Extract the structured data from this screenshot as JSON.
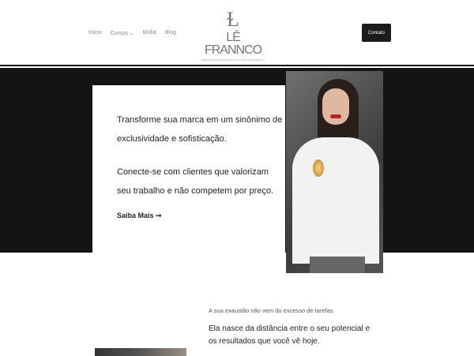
{
  "header": {
    "nav": [
      "Início",
      "Cursos ⌄",
      "Mídia",
      "Blog"
    ],
    "logo": {
      "monogram": "LF",
      "name": "LÊ FRANNCO",
      "tagline": "MENTORA MARCA PESSOAL E POSICIONAMENTO"
    },
    "contact_label": "Contato"
  },
  "hero": {
    "p1": "Transforme sua marca em um sinônimo de exclusividade e sofisticação.",
    "p2": "Conecte-se com clientes que valorizam seu trabalho e não competem por preço.",
    "cta": "Saiba Mais ➞"
  },
  "section": {
    "intro": "A sua exaustão não vem do excesso de tarefas.",
    "lead": "Ela nasce da distância entre o seu potencial e os resultados que você vê hoje."
  }
}
